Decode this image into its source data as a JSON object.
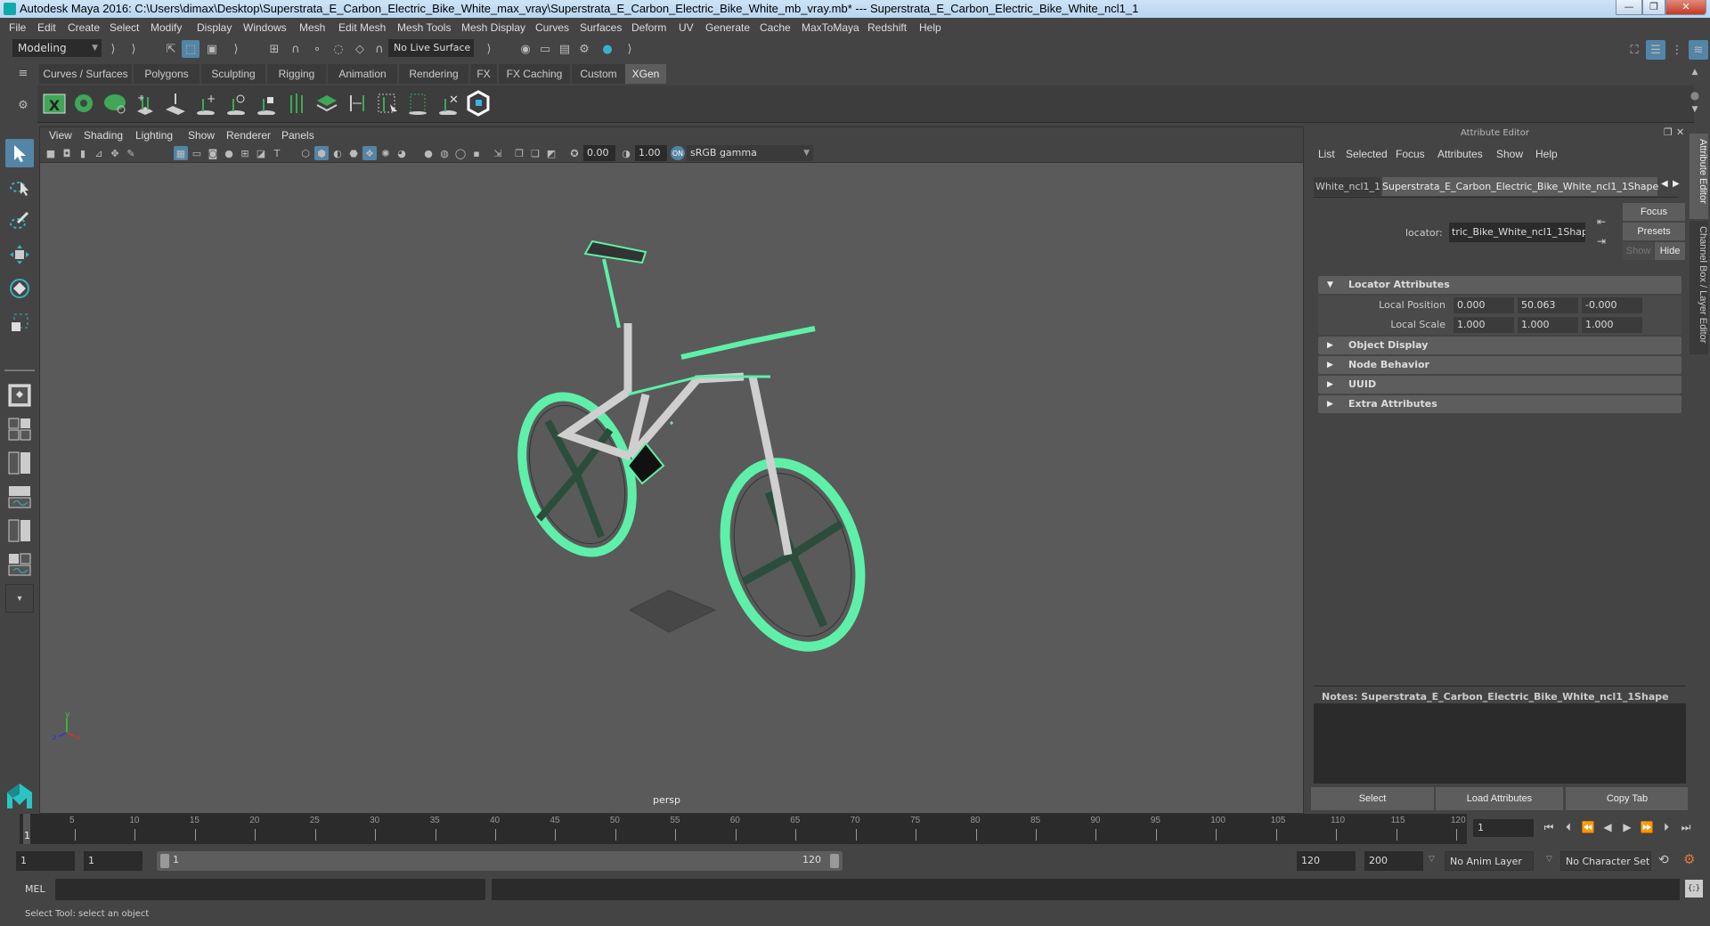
{
  "window": {
    "title": "Autodesk Maya 2016: C:\\Users\\dimax\\Desktop\\Superstrata_E_Carbon_Electric_Bike_White_max_vray\\Superstrata_E_Carbon_Electric_Bike_White_mb_vray.mb*   ---   Superstrata_E_Carbon_Electric_Bike_White_ncl1_1",
    "minimize": "—",
    "restore": "❐",
    "close": "✕"
  },
  "menubar": [
    "File",
    "Edit",
    "Create",
    "Select",
    "Modify",
    "Display",
    "Windows",
    "Mesh",
    "Edit Mesh",
    "Mesh Tools",
    "Mesh Display",
    "Curves",
    "Surfaces",
    "Deform",
    "UV",
    "Generate",
    "Cache",
    "MaxToMaya",
    "Redshift",
    "Help"
  ],
  "statusline": {
    "menuset": "Modeling",
    "live_surface": "No Live Surface"
  },
  "shelf": {
    "tabs": [
      "Curves / Surfaces",
      "Polygons",
      "Sculpting",
      "Rigging",
      "Animation",
      "Rendering",
      "FX",
      "FX Caching",
      "Custom",
      "XGen"
    ],
    "active_tab": "XGen",
    "icons": [
      "xgen-editor-icon",
      "xgen-preview-icon",
      "xgen-clear-preview-icon",
      "add-guides-icon",
      "place-guides-icon",
      "add-guide-icon",
      "show-guides-icon",
      "lock-guides-icon",
      "guides-to-curves-icon",
      "sculpt-layers-icon",
      "guide-length-icon",
      "select-guides-icon",
      "guide-boundary-icon",
      "delete-guides-icon",
      "redshift-logo-icon"
    ]
  },
  "viewport": {
    "menus": [
      "View",
      "Shading",
      "Lighting",
      "Show",
      "Renderer",
      "Panels"
    ],
    "exposure": "0.00",
    "gamma": "1.00",
    "color_space": "sRGB gamma",
    "camera_label": "persp",
    "wireframe_color": "#5ef0a8"
  },
  "attribute_editor": {
    "title": "Attribute Editor",
    "menus": [
      "List",
      "Selected",
      "Focus",
      "Attributes",
      "Show",
      "Help"
    ],
    "tabs": [
      "White_ncl1_1",
      "Superstrata_E_Carbon_Electric_Bike_White_ncl1_1Shape"
    ],
    "active_tab": "Superstrata_E_Carbon_Electric_Bike_White_ncl1_1Shape",
    "node_label": "locator:",
    "node_value": "tric_Bike_White_ncl1_1Shape",
    "buttons": {
      "focus": "Focus",
      "presets": "Presets",
      "show": "Show",
      "hide": "Hide"
    },
    "sections": [
      {
        "label": "Locator Attributes",
        "expanded": true
      },
      {
        "label": "Object Display",
        "expanded": false
      },
      {
        "label": "Node Behavior",
        "expanded": false
      },
      {
        "label": "UUID",
        "expanded": false
      },
      {
        "label": "Extra Attributes",
        "expanded": false
      }
    ],
    "local_position": {
      "label": "Local Position",
      "values": [
        "0.000",
        "50.063",
        "-0.000"
      ]
    },
    "local_scale": {
      "label": "Local Scale",
      "values": [
        "1.000",
        "1.000",
        "1.000"
      ]
    },
    "notes_label": "Notes:  Superstrata_E_Carbon_Electric_Bike_White_ncl1_1Shape",
    "notes_text": "",
    "bottom_buttons": [
      "Select",
      "Load Attributes",
      "Copy Tab"
    ]
  },
  "side_tabs": [
    "Attribute Editor",
    "Channel Box / Layer Editor"
  ],
  "timeline": {
    "ticks": [
      5,
      10,
      15,
      20,
      25,
      30,
      35,
      40,
      45,
      50,
      55,
      60,
      65,
      70,
      75,
      80,
      85,
      90,
      95,
      100,
      105,
      110,
      115,
      120
    ],
    "range_min": 1,
    "range_max": 120,
    "current_frame": "1",
    "current_frame_field": "1"
  },
  "range": {
    "start": "1",
    "playback_start": "1",
    "slider_start": "1",
    "slider_end": "120",
    "playback_end": "120",
    "end": "200",
    "anim_layer": "No Anim Layer",
    "character_set": "No Character Set"
  },
  "command_line": {
    "language": "MEL",
    "input": "",
    "result": ""
  },
  "help_line": "Select Tool: select an object"
}
